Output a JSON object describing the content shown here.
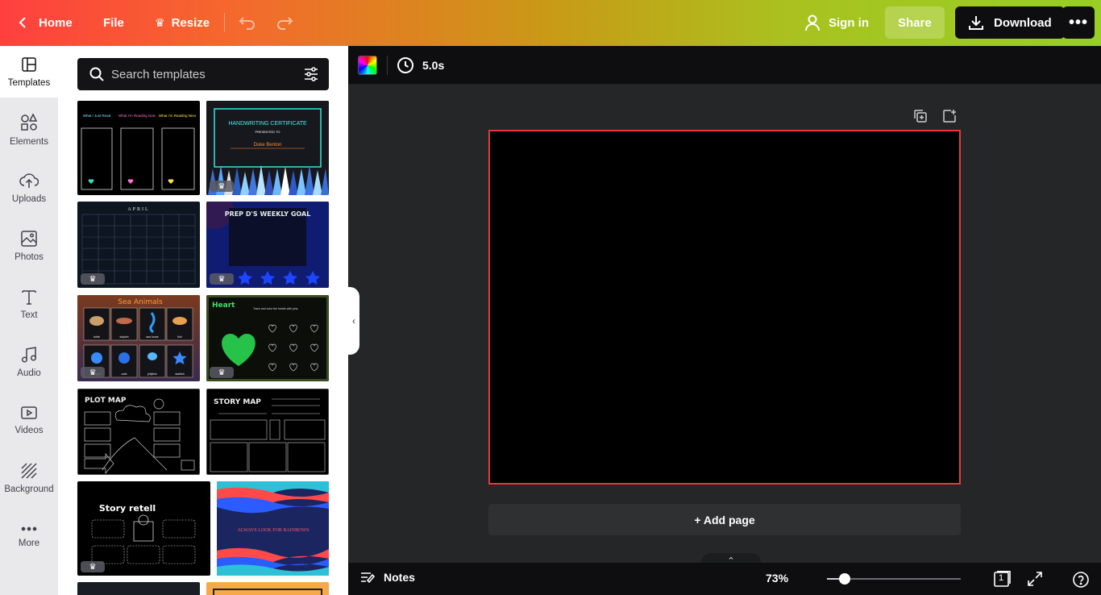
{
  "topbar": {
    "home_label": "Home",
    "file_label": "File",
    "resize_label": "Resize",
    "signin_label": "Sign in",
    "share_label": "Share",
    "download_label": "Download",
    "more_label": "•••"
  },
  "rail": {
    "items": [
      {
        "label": "Templates",
        "icon": "templates-icon"
      },
      {
        "label": "Elements",
        "icon": "elements-icon"
      },
      {
        "label": "Uploads",
        "icon": "upload-icon"
      },
      {
        "label": "Photos",
        "icon": "photo-icon"
      },
      {
        "label": "Text",
        "icon": "text-icon"
      },
      {
        "label": "Audio",
        "icon": "music-note-icon"
      },
      {
        "label": "Videos",
        "icon": "video-icon"
      },
      {
        "label": "Background",
        "icon": "background-icon"
      },
      {
        "label": "More",
        "icon": "more-dots-icon"
      }
    ]
  },
  "search": {
    "placeholder": "Search templates"
  },
  "templates": [
    {
      "labels": [
        "What I Just Read",
        "What I'm Reading Now",
        "What I'm Reading Next"
      ]
    },
    {
      "title": "HANDWRITING CERTIFICATE",
      "subtitle": "PRESENTED TO",
      "name": "Duke Benton"
    },
    {
      "title": "APRIL"
    },
    {
      "title": "PREP D'S WEEKLY GOAL"
    },
    {
      "title": "Sea Animals",
      "items": [
        "turtle",
        "dolphin",
        "sea horse",
        "fish",
        "octopus",
        "crab",
        "jellyfish",
        "starfish"
      ]
    },
    {
      "title": "Heart",
      "subtitle": "Trace and color the hearts with pins."
    },
    {
      "title": "PLOT MAP"
    },
    {
      "title": "STORY MAP"
    },
    {
      "title": "Story retell"
    },
    {
      "title": "ALWAYS LOOK FOR RAINBOWS"
    }
  ],
  "canvas_toolbar": {
    "duration": "5.0s"
  },
  "canvas": {
    "add_page_label": "+ Add page",
    "page_background": "#000000",
    "selection_color": "#e8383d"
  },
  "bottombar": {
    "notes_label": "Notes",
    "zoom_label": "73%",
    "zoom_fraction": 0.13,
    "page_count": "1"
  },
  "colors": {
    "gradient_start": "#ff3f3f",
    "gradient_end": "#97cf24",
    "workspace_bg": "#252627",
    "dark_button": "#0e0e10"
  }
}
